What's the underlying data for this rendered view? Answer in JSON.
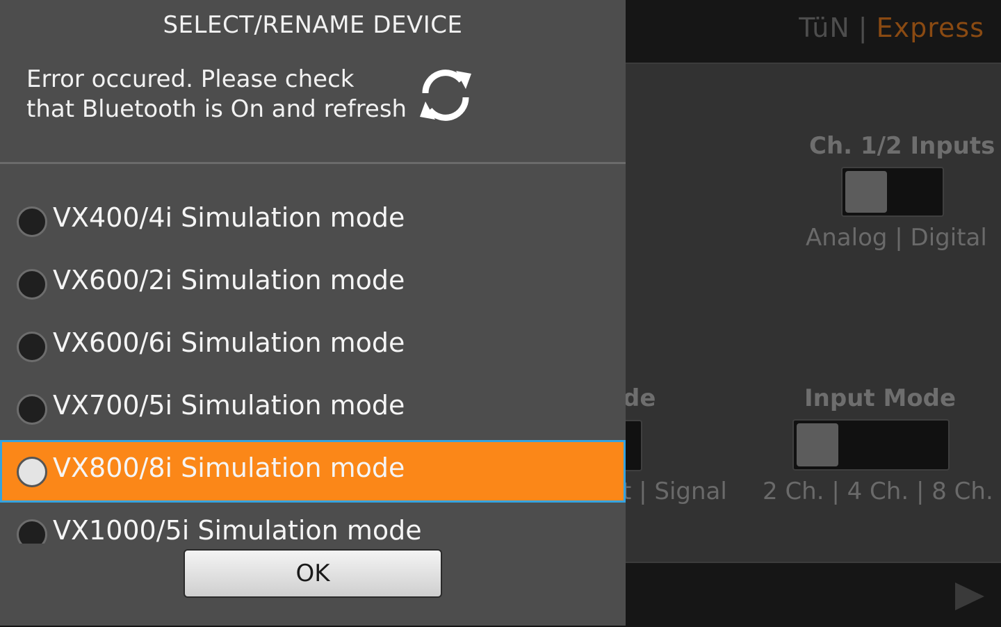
{
  "background": {
    "brand": {
      "left": "TüN",
      "separator": "|",
      "right": "Express"
    },
    "ch_inputs": {
      "title": "Ch. 1/2 Inputs",
      "options": "Analog | Digital"
    },
    "partial_mode": {
      "title_fragment": "de",
      "options_fragment": "t | Signal"
    },
    "input_mode": {
      "title": "Input Mode",
      "options": "2 Ch. | 4 Ch. | 8 Ch."
    }
  },
  "dialog": {
    "title": "SELECT/RENAME DEVICE",
    "error_line1": "Error occured. Please check",
    "error_line2": "that Bluetooth is On and refresh",
    "ok_label": "OK",
    "devices": [
      {
        "label": "VX400/4i Simulation mode",
        "selected": false
      },
      {
        "label": "VX600/2i Simulation mode",
        "selected": false
      },
      {
        "label": "VX600/6i Simulation mode",
        "selected": false
      },
      {
        "label": "VX700/5i Simulation mode",
        "selected": false
      },
      {
        "label": "VX800/8i Simulation mode",
        "selected": true
      },
      {
        "label": "VX1000/5i Simulation mode",
        "selected": false
      }
    ]
  },
  "colors": {
    "accent": "#fb8718",
    "focus_border": "#35a3e0",
    "brand_express": "#8a4a12"
  }
}
